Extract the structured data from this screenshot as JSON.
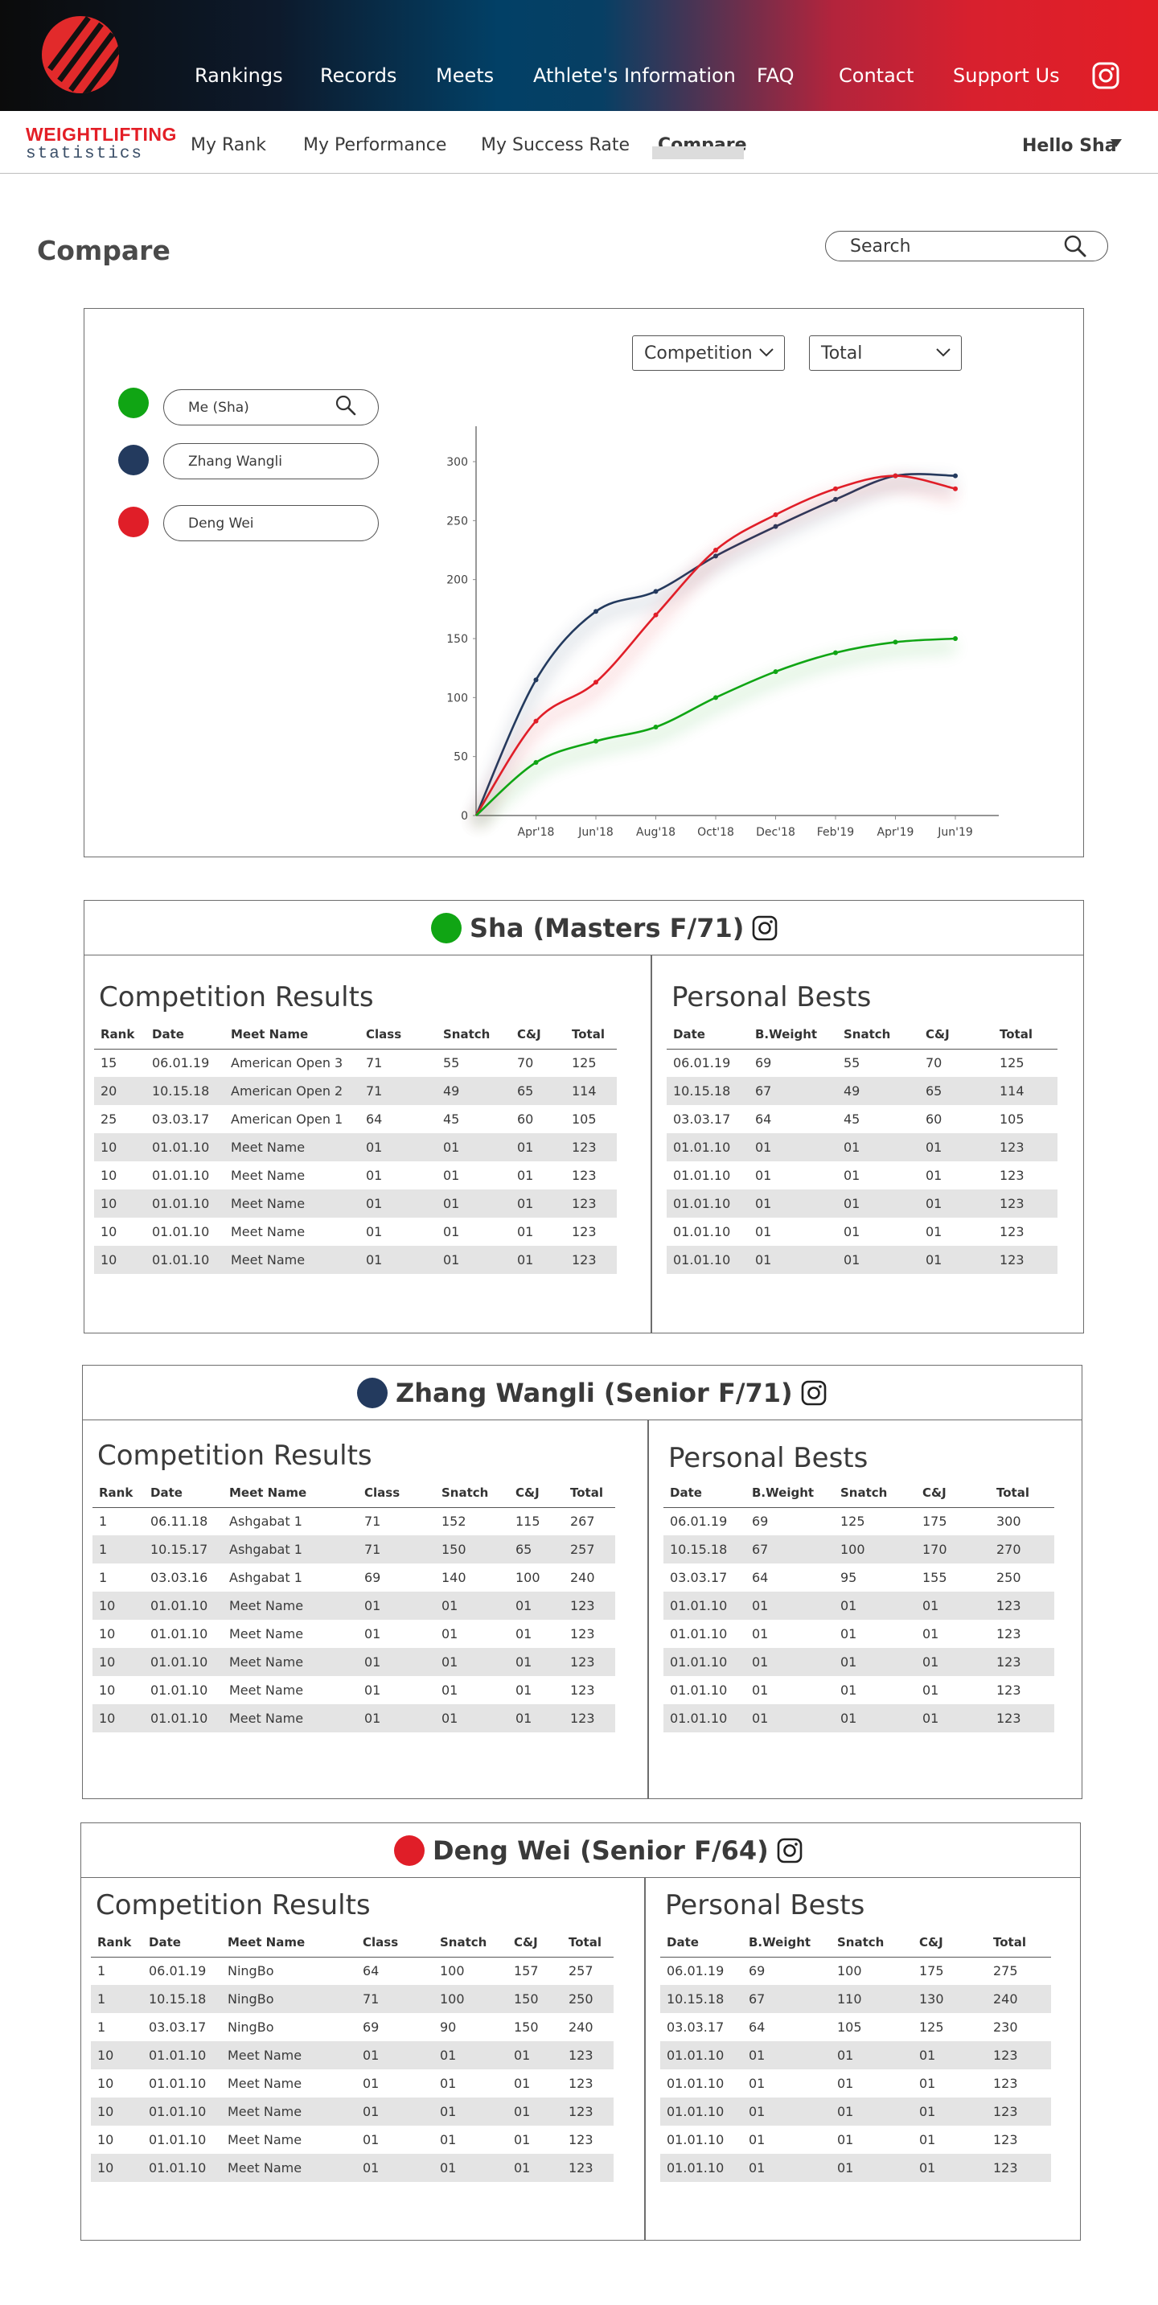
{
  "header": {
    "nav": [
      "Rankings",
      "Records",
      "Meets",
      "Athlete's Information",
      "FAQ",
      "Contact",
      "Support Us"
    ],
    "instagram_icon": "instagram-icon",
    "logo_icon": "weightlifting-stripes-logo"
  },
  "brand": {
    "line1": "WEIGHTLIFTING",
    "line2": "statistics"
  },
  "subnav": {
    "items": [
      "My Rank",
      "My Performance",
      "My Success Rate",
      "Compare"
    ],
    "active": "Compare",
    "user": "Hello Sha"
  },
  "page": {
    "title": "Compare",
    "search_placeholder": "Search"
  },
  "colors": {
    "green": "#10a514",
    "navy": "#233a5e",
    "red": "#e01e28",
    "header_start": "#0b0b0b",
    "header_mid": "#024066",
    "header_end": "#e31e26"
  },
  "compare_panel": {
    "athletes": [
      {
        "label": "Me (Sha)",
        "color": "#10a514"
      },
      {
        "label": "Zhang Wangli",
        "color": "#233a5e"
      },
      {
        "label": "Deng Wei",
        "color": "#e01e28"
      }
    ],
    "dropdowns": {
      "metric_type": "Competition",
      "lift": "Total"
    }
  },
  "chart_data": {
    "type": "line",
    "title": "",
    "xlabel": "",
    "ylabel": "",
    "categories": [
      "",
      "Apr'18",
      "Jun'18",
      "Aug'18",
      "Oct'18",
      "Dec'18",
      "Feb'19",
      "Apr'19",
      "Jun'19"
    ],
    "ylim": [
      0,
      330
    ],
    "yticks": [
      0,
      50,
      100,
      150,
      200,
      250,
      300
    ],
    "grid": false,
    "legend": "none",
    "series": [
      {
        "color": "#233a5e",
        "values": [
          0,
          115,
          173,
          190,
          220,
          245,
          268,
          288,
          288
        ]
      },
      {
        "color": "#e01e28",
        "values": [
          0,
          80,
          113,
          170,
          225,
          255,
          277,
          288,
          277
        ]
      },
      {
        "color": "#10a514",
        "values": [
          0,
          45,
          63,
          75,
          100,
          122,
          138,
          147,
          150
        ]
      }
    ]
  },
  "sections": [
    {
      "athlete": "Sha (Masters F/71)",
      "color": "#10a514",
      "competition": {
        "title": "Competition Results",
        "headers": [
          "Rank",
          "Date",
          "Meet Name",
          "Class",
          "Snatch",
          "C&J",
          "Total"
        ],
        "rows": [
          [
            "15",
            "06.01.19",
            "American Open 3",
            "71",
            "55",
            "70",
            "125"
          ],
          [
            "20",
            "10.15.18",
            "American Open 2",
            "71",
            "49",
            "65",
            "114"
          ],
          [
            "25",
            "03.03.17",
            "American Open 1",
            "64",
            "45",
            "60",
            "105"
          ],
          [
            "10",
            "01.01.10",
            "Meet Name",
            "01",
            "01",
            "01",
            "123"
          ],
          [
            "10",
            "01.01.10",
            "Meet Name",
            "01",
            "01",
            "01",
            "123"
          ],
          [
            "10",
            "01.01.10",
            "Meet Name",
            "01",
            "01",
            "01",
            "123"
          ],
          [
            "10",
            "01.01.10",
            "Meet Name",
            "01",
            "01",
            "01",
            "123"
          ],
          [
            "10",
            "01.01.10",
            "Meet Name",
            "01",
            "01",
            "01",
            "123"
          ]
        ]
      },
      "bests": {
        "title": "Personal Bests",
        "headers": [
          "Date",
          "B.Weight",
          "Snatch",
          "C&J",
          "Total"
        ],
        "rows": [
          [
            "06.01.19",
            "69",
            "55",
            "70",
            "125"
          ],
          [
            "10.15.18",
            "67",
            "49",
            "65",
            "114"
          ],
          [
            "03.03.17",
            "64",
            "45",
            "60",
            "105"
          ],
          [
            "01.01.10",
            "01",
            "01",
            "01",
            "123"
          ],
          [
            "01.01.10",
            "01",
            "01",
            "01",
            "123"
          ],
          [
            "01.01.10",
            "01",
            "01",
            "01",
            "123"
          ],
          [
            "01.01.10",
            "01",
            "01",
            "01",
            "123"
          ],
          [
            "01.01.10",
            "01",
            "01",
            "01",
            "123"
          ]
        ]
      }
    },
    {
      "athlete": "Zhang Wangli  (Senior F/71)",
      "color": "#233a5e",
      "competition": {
        "title": "Competition Results",
        "headers": [
          "Rank",
          "Date",
          "Meet Name",
          "Class",
          "Snatch",
          "C&J",
          "Total"
        ],
        "rows": [
          [
            "1",
            "06.11.18",
            "Ashgabat 1",
            "71",
            "152",
            "115",
            "267"
          ],
          [
            "1",
            "10.15.17",
            "Ashgabat 1",
            "71",
            "150",
            "65",
            "257"
          ],
          [
            "1",
            "03.03.16",
            "Ashgabat 1",
            "69",
            "140",
            "100",
            "240"
          ],
          [
            "10",
            "01.01.10",
            "Meet Name",
            "01",
            "01",
            "01",
            "123"
          ],
          [
            "10",
            "01.01.10",
            "Meet Name",
            "01",
            "01",
            "01",
            "123"
          ],
          [
            "10",
            "01.01.10",
            "Meet Name",
            "01",
            "01",
            "01",
            "123"
          ],
          [
            "10",
            "01.01.10",
            "Meet Name",
            "01",
            "01",
            "01",
            "123"
          ],
          [
            "10",
            "01.01.10",
            "Meet Name",
            "01",
            "01",
            "01",
            "123"
          ]
        ]
      },
      "bests": {
        "title": "Personal Bests",
        "headers": [
          "Date",
          "B.Weight",
          "Snatch",
          "C&J",
          "Total"
        ],
        "rows": [
          [
            "06.01.19",
            "69",
            "125",
            "175",
            "300"
          ],
          [
            "10.15.18",
            "67",
            "100",
            "170",
            "270"
          ],
          [
            "03.03.17",
            "64",
            "95",
            "155",
            "250"
          ],
          [
            "01.01.10",
            "01",
            "01",
            "01",
            "123"
          ],
          [
            "01.01.10",
            "01",
            "01",
            "01",
            "123"
          ],
          [
            "01.01.10",
            "01",
            "01",
            "01",
            "123"
          ],
          [
            "01.01.10",
            "01",
            "01",
            "01",
            "123"
          ],
          [
            "01.01.10",
            "01",
            "01",
            "01",
            "123"
          ]
        ]
      }
    },
    {
      "athlete": "Deng Wei (Senior F/64)",
      "color": "#e01e28",
      "competition": {
        "title": "Competition Results",
        "headers": [
          "Rank",
          "Date",
          "Meet Name",
          "Class",
          "Snatch",
          "C&J",
          "Total"
        ],
        "rows": [
          [
            "1",
            "06.01.19",
            "NingBo",
            "64",
            "100",
            "157",
            "257"
          ],
          [
            "1",
            "10.15.18",
            "NingBo",
            "71",
            "100",
            "150",
            "250"
          ],
          [
            "1",
            "03.03.17",
            "NingBo",
            "69",
            "90",
            "150",
            "240"
          ],
          [
            "10",
            "01.01.10",
            "Meet Name",
            "01",
            "01",
            "01",
            "123"
          ],
          [
            "10",
            "01.01.10",
            "Meet Name",
            "01",
            "01",
            "01",
            "123"
          ],
          [
            "10",
            "01.01.10",
            "Meet Name",
            "01",
            "01",
            "01",
            "123"
          ],
          [
            "10",
            "01.01.10",
            "Meet Name",
            "01",
            "01",
            "01",
            "123"
          ],
          [
            "10",
            "01.01.10",
            "Meet Name",
            "01",
            "01",
            "01",
            "123"
          ]
        ]
      },
      "bests": {
        "title": "Personal Bests",
        "headers": [
          "Date",
          "B.Weight",
          "Snatch",
          "C&J",
          "Total"
        ],
        "rows": [
          [
            "06.01.19",
            "69",
            "100",
            "175",
            "275"
          ],
          [
            "10.15.18",
            "67",
            "110",
            "130",
            "240"
          ],
          [
            "03.03.17",
            "64",
            "105",
            "125",
            "230"
          ],
          [
            "01.01.10",
            "01",
            "01",
            "01",
            "123"
          ],
          [
            "01.01.10",
            "01",
            "01",
            "01",
            "123"
          ],
          [
            "01.01.10",
            "01",
            "01",
            "01",
            "123"
          ],
          [
            "01.01.10",
            "01",
            "01",
            "01",
            "123"
          ],
          [
            "01.01.10",
            "01",
            "01",
            "01",
            "123"
          ]
        ]
      }
    }
  ]
}
